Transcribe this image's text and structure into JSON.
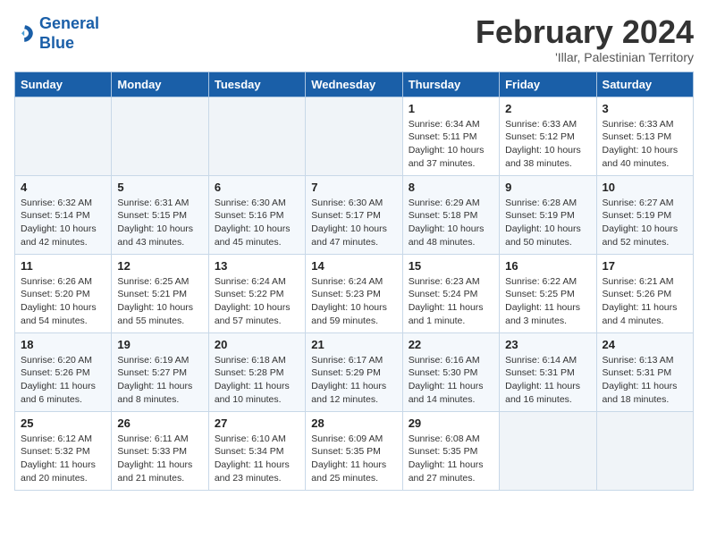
{
  "logo": {
    "line1": "General",
    "line2": "Blue"
  },
  "title": "February 2024",
  "subtitle": "'Illar, Palestinian Territory",
  "days_of_week": [
    "Sunday",
    "Monday",
    "Tuesday",
    "Wednesday",
    "Thursday",
    "Friday",
    "Saturday"
  ],
  "weeks": [
    [
      {
        "day": "",
        "info": ""
      },
      {
        "day": "",
        "info": ""
      },
      {
        "day": "",
        "info": ""
      },
      {
        "day": "",
        "info": ""
      },
      {
        "day": "1",
        "info": "Sunrise: 6:34 AM\nSunset: 5:11 PM\nDaylight: 10 hours\nand 37 minutes."
      },
      {
        "day": "2",
        "info": "Sunrise: 6:33 AM\nSunset: 5:12 PM\nDaylight: 10 hours\nand 38 minutes."
      },
      {
        "day": "3",
        "info": "Sunrise: 6:33 AM\nSunset: 5:13 PM\nDaylight: 10 hours\nand 40 minutes."
      }
    ],
    [
      {
        "day": "4",
        "info": "Sunrise: 6:32 AM\nSunset: 5:14 PM\nDaylight: 10 hours\nand 42 minutes."
      },
      {
        "day": "5",
        "info": "Sunrise: 6:31 AM\nSunset: 5:15 PM\nDaylight: 10 hours\nand 43 minutes."
      },
      {
        "day": "6",
        "info": "Sunrise: 6:30 AM\nSunset: 5:16 PM\nDaylight: 10 hours\nand 45 minutes."
      },
      {
        "day": "7",
        "info": "Sunrise: 6:30 AM\nSunset: 5:17 PM\nDaylight: 10 hours\nand 47 minutes."
      },
      {
        "day": "8",
        "info": "Sunrise: 6:29 AM\nSunset: 5:18 PM\nDaylight: 10 hours\nand 48 minutes."
      },
      {
        "day": "9",
        "info": "Sunrise: 6:28 AM\nSunset: 5:19 PM\nDaylight: 10 hours\nand 50 minutes."
      },
      {
        "day": "10",
        "info": "Sunrise: 6:27 AM\nSunset: 5:19 PM\nDaylight: 10 hours\nand 52 minutes."
      }
    ],
    [
      {
        "day": "11",
        "info": "Sunrise: 6:26 AM\nSunset: 5:20 PM\nDaylight: 10 hours\nand 54 minutes."
      },
      {
        "day": "12",
        "info": "Sunrise: 6:25 AM\nSunset: 5:21 PM\nDaylight: 10 hours\nand 55 minutes."
      },
      {
        "day": "13",
        "info": "Sunrise: 6:24 AM\nSunset: 5:22 PM\nDaylight: 10 hours\nand 57 minutes."
      },
      {
        "day": "14",
        "info": "Sunrise: 6:24 AM\nSunset: 5:23 PM\nDaylight: 10 hours\nand 59 minutes."
      },
      {
        "day": "15",
        "info": "Sunrise: 6:23 AM\nSunset: 5:24 PM\nDaylight: 11 hours\nand 1 minute."
      },
      {
        "day": "16",
        "info": "Sunrise: 6:22 AM\nSunset: 5:25 PM\nDaylight: 11 hours\nand 3 minutes."
      },
      {
        "day": "17",
        "info": "Sunrise: 6:21 AM\nSunset: 5:26 PM\nDaylight: 11 hours\nand 4 minutes."
      }
    ],
    [
      {
        "day": "18",
        "info": "Sunrise: 6:20 AM\nSunset: 5:26 PM\nDaylight: 11 hours\nand 6 minutes."
      },
      {
        "day": "19",
        "info": "Sunrise: 6:19 AM\nSunset: 5:27 PM\nDaylight: 11 hours\nand 8 minutes."
      },
      {
        "day": "20",
        "info": "Sunrise: 6:18 AM\nSunset: 5:28 PM\nDaylight: 11 hours\nand 10 minutes."
      },
      {
        "day": "21",
        "info": "Sunrise: 6:17 AM\nSunset: 5:29 PM\nDaylight: 11 hours\nand 12 minutes."
      },
      {
        "day": "22",
        "info": "Sunrise: 6:16 AM\nSunset: 5:30 PM\nDaylight: 11 hours\nand 14 minutes."
      },
      {
        "day": "23",
        "info": "Sunrise: 6:14 AM\nSunset: 5:31 PM\nDaylight: 11 hours\nand 16 minutes."
      },
      {
        "day": "24",
        "info": "Sunrise: 6:13 AM\nSunset: 5:31 PM\nDaylight: 11 hours\nand 18 minutes."
      }
    ],
    [
      {
        "day": "25",
        "info": "Sunrise: 6:12 AM\nSunset: 5:32 PM\nDaylight: 11 hours\nand 20 minutes."
      },
      {
        "day": "26",
        "info": "Sunrise: 6:11 AM\nSunset: 5:33 PM\nDaylight: 11 hours\nand 21 minutes."
      },
      {
        "day": "27",
        "info": "Sunrise: 6:10 AM\nSunset: 5:34 PM\nDaylight: 11 hours\nand 23 minutes."
      },
      {
        "day": "28",
        "info": "Sunrise: 6:09 AM\nSunset: 5:35 PM\nDaylight: 11 hours\nand 25 minutes."
      },
      {
        "day": "29",
        "info": "Sunrise: 6:08 AM\nSunset: 5:35 PM\nDaylight: 11 hours\nand 27 minutes."
      },
      {
        "day": "",
        "info": ""
      },
      {
        "day": "",
        "info": ""
      }
    ]
  ]
}
